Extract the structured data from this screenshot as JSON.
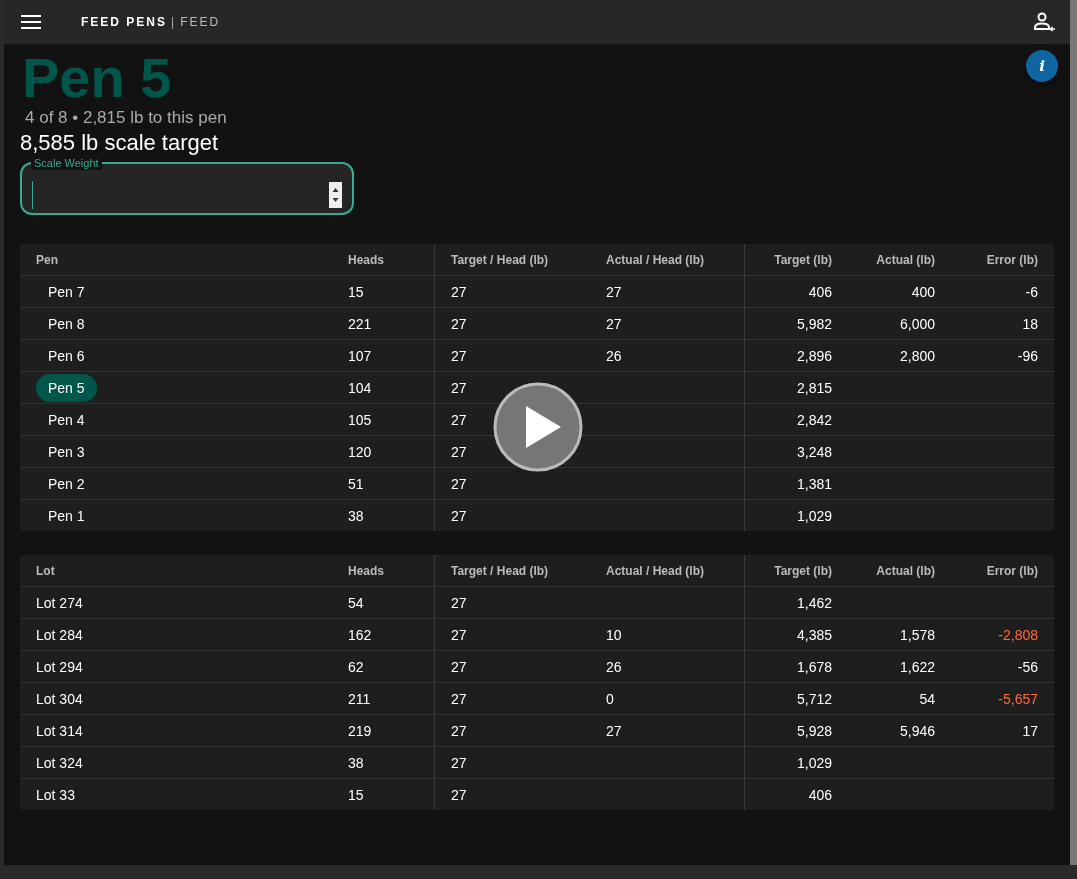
{
  "app_bar": {
    "title": "FEED PENS",
    "separator": "|",
    "subtitle": "FEED"
  },
  "pen": {
    "name": "Pen 5",
    "summary": "4 of 8 • 2,815 lb to this pen",
    "scale_target": "8,585 lb scale target"
  },
  "info_button": {
    "glyph": "i"
  },
  "scale_weight": {
    "label": "Scale Weight"
  },
  "pen_table": {
    "columns": [
      "Pen",
      "Heads",
      "Target / Head (lb)",
      "Actual / Head (lb)",
      "Target (lb)",
      "Actual (lb)",
      "Error (lb)"
    ],
    "rows": [
      {
        "cells": [
          "Pen 7",
          "15",
          "27",
          "27",
          "406",
          "400",
          "-6"
        ],
        "selected": false
      },
      {
        "cells": [
          "Pen 8",
          "221",
          "27",
          "27",
          "5,982",
          "6,000",
          "18"
        ],
        "selected": false
      },
      {
        "cells": [
          "Pen 6",
          "107",
          "27",
          "26",
          "2,896",
          "2,800",
          "-96"
        ],
        "selected": false
      },
      {
        "cells": [
          "Pen 5",
          "104",
          "27",
          "",
          "2,815",
          "",
          ""
        ],
        "selected": true
      },
      {
        "cells": [
          "Pen 4",
          "105",
          "27",
          "",
          "2,842",
          "",
          ""
        ],
        "selected": false
      },
      {
        "cells": [
          "Pen 3",
          "120",
          "27",
          "",
          "3,248",
          "",
          ""
        ],
        "selected": false
      },
      {
        "cells": [
          "Pen 2",
          "51",
          "27",
          "",
          "1,381",
          "",
          ""
        ],
        "selected": false
      },
      {
        "cells": [
          "Pen 1",
          "38",
          "27",
          "",
          "1,029",
          "",
          ""
        ],
        "selected": false
      }
    ]
  },
  "lot_table": {
    "columns": [
      "Lot",
      "Heads",
      "Target / Head (lb)",
      "Actual / Head (lb)",
      "Target (lb)",
      "Actual (lb)",
      "Error (lb)"
    ],
    "rows": [
      {
        "cells": [
          "Lot 274",
          "54",
          "27",
          "",
          "1,462",
          "",
          ""
        ]
      },
      {
        "cells": [
          "Lot 284",
          "162",
          "27",
          "10",
          "4,385",
          "1,578",
          "-2,808"
        ],
        "error_alert": true
      },
      {
        "cells": [
          "Lot 294",
          "62",
          "27",
          "26",
          "1,678",
          "1,622",
          "-56"
        ],
        "error_alert": false
      },
      {
        "cells": [
          "Lot 304",
          "211",
          "27",
          "0",
          "5,712",
          "54",
          "-5,657"
        ],
        "error_alert": true
      },
      {
        "cells": [
          "Lot 314",
          "219",
          "27",
          "27",
          "5,928",
          "5,946",
          "17"
        ],
        "error_alert": false
      },
      {
        "cells": [
          "Lot 324",
          "38",
          "27",
          "",
          "1,029",
          "",
          ""
        ]
      },
      {
        "cells": [
          "Lot 33",
          "15",
          "27",
          "",
          "406",
          "",
          ""
        ]
      }
    ]
  }
}
